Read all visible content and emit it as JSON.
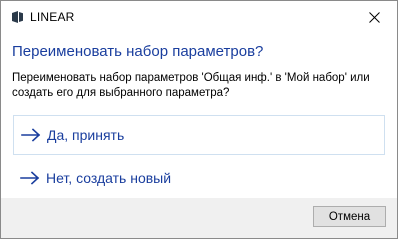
{
  "window": {
    "title": "LINEAR",
    "icon": "linear-logo-icon",
    "close_icon": "close-icon"
  },
  "dialog": {
    "heading": "Переименовать набор параметров?",
    "description": "Переименовать набор параметров 'Общая инф.' в 'Мой набор' или создать его для выбранного параметра?",
    "options": [
      {
        "label": "Да, принять",
        "icon": "arrow-right-icon",
        "focused": true
      },
      {
        "label": "Нет, создать новый",
        "icon": "arrow-right-icon",
        "focused": false
      }
    ],
    "cancel_label": "Отмена"
  },
  "colors": {
    "heading": "#1a3e9e",
    "link": "#1a3e9e",
    "footer_bg": "#f0f0f0",
    "focus_border": "#cfe0f0"
  }
}
